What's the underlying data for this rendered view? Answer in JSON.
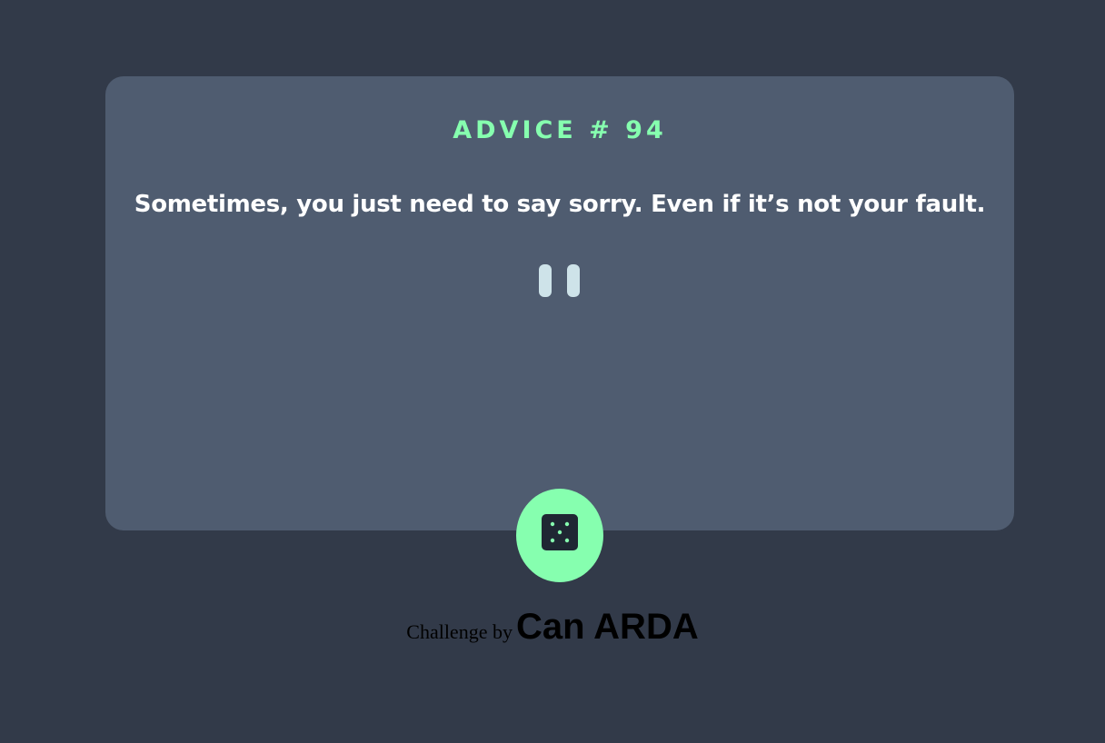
{
  "card": {
    "advice_id": "ADVICE # 94",
    "advice_text": "Sometimes, you just need to say sorry. Even if it’s not your fault."
  },
  "divider": {
    "icon": "pause-divider-icon"
  },
  "dice_button": {
    "icon": "dice-icon"
  },
  "footer": {
    "prefix": "Challenge by",
    "author": "Can ARDA"
  },
  "colors": {
    "background": "#323a49",
    "card": "#4f5c70",
    "accent": "#86ffaf",
    "text": "#ffffff",
    "divider": "#cee3e9"
  }
}
